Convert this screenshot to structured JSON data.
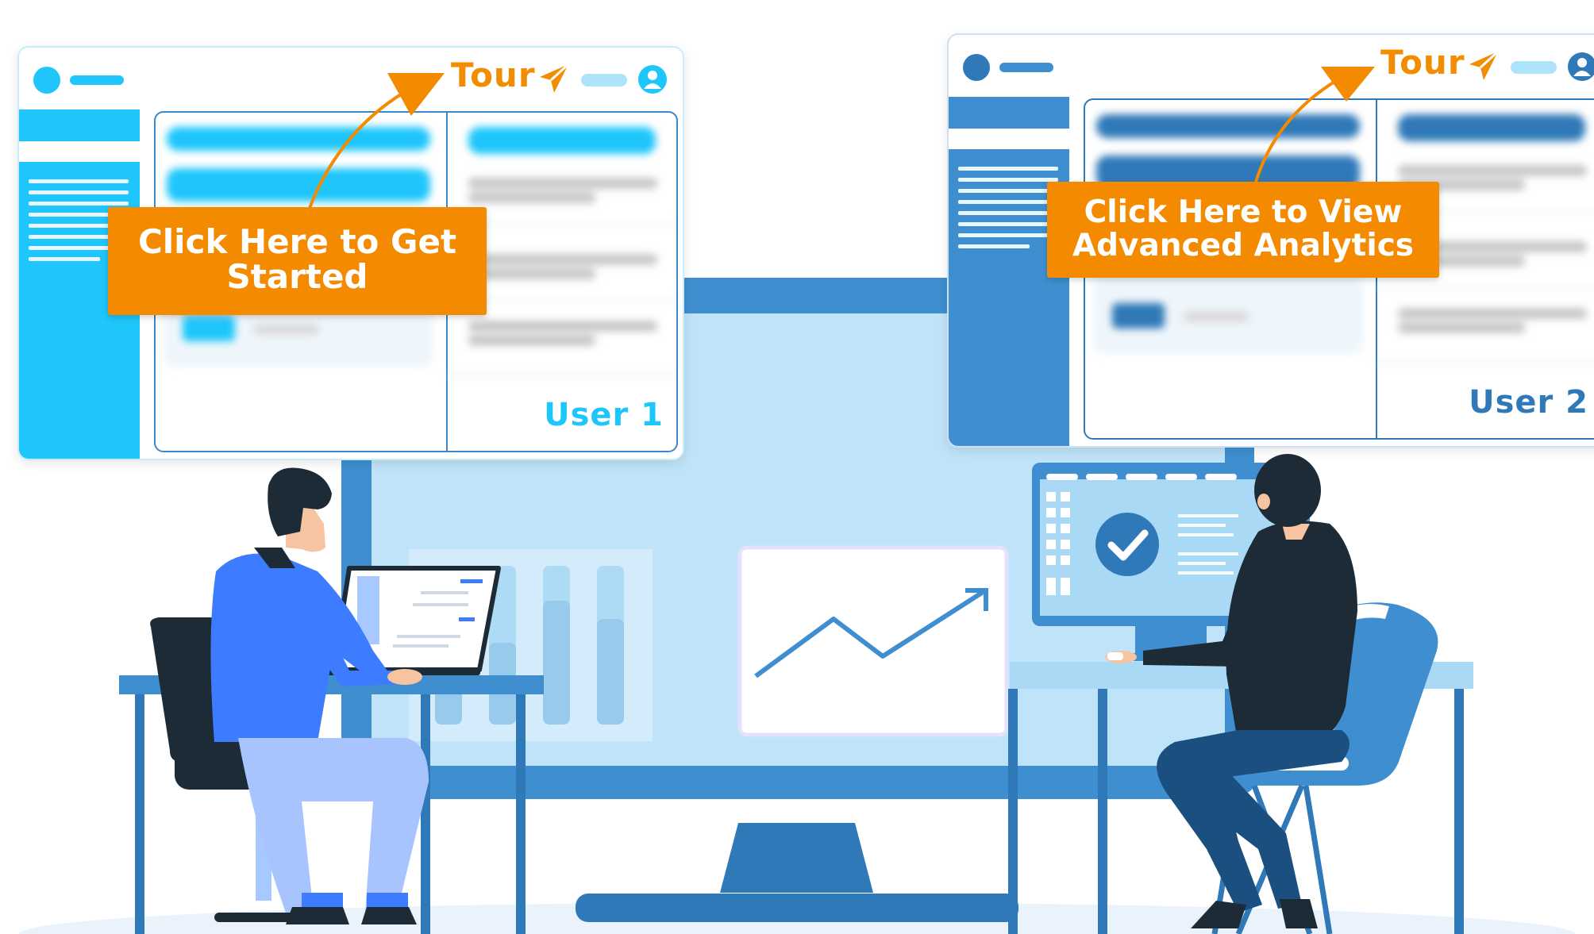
{
  "user1_window": {
    "tour_label": "Tour",
    "user_label": "User 1",
    "callout": [
      "Click Here to Get",
      "Started"
    ]
  },
  "user2_window": {
    "tour_label": "Tour",
    "user_label": "User 2",
    "callout": [
      "Click Here to View",
      "Advanced Analytics"
    ]
  },
  "icons": [
    "paper-plane-icon",
    "user-avatar-icon",
    "checkmark-icon",
    "trend-arrow-icon"
  ],
  "colors": {
    "accent_orange": "#f38a00",
    "light_blue": "#1ec6fb",
    "dark_blue": "#3f8fd0",
    "navy": "#1d2b36"
  }
}
